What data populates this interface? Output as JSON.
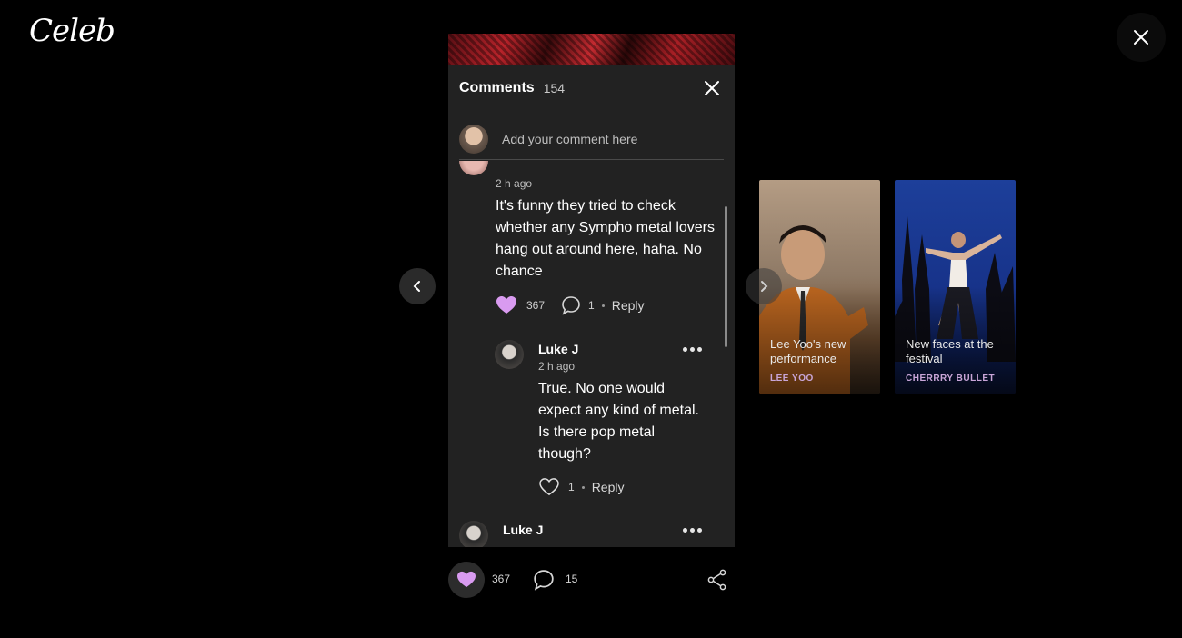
{
  "app": {
    "logo": "Celeb"
  },
  "comments_panel": {
    "title": "Comments",
    "count": "154",
    "add_comment_placeholder": "Add your comment here",
    "thread": [
      {
        "time": "2 h ago",
        "text": "It's funny they tried to check whether any Sympho metal lovers hang out around here, haha. No chance",
        "likes": "367",
        "replies": "1",
        "reply_label": "Reply",
        "liked": true,
        "reply_items": [
          {
            "author": "Luke J",
            "time": "2 h ago",
            "text": "True. No one would expect any kind of metal. Is there pop metal though?",
            "likes": "1",
            "reply_label": "Reply",
            "liked": false
          }
        ]
      },
      {
        "author": "Luke J"
      }
    ]
  },
  "post_actions": {
    "likes": "367",
    "comments": "15"
  },
  "related": [
    {
      "title": "Lee Yoo's new performance",
      "tag": "LEE YOO",
      "tag_color": "#c9a6d8"
    },
    {
      "title": "New faces at the festival",
      "tag": "CHERRRY BULLET",
      "tag_color": "#c9a6d8"
    }
  ],
  "colors": {
    "accent": "#d99bf0",
    "background": "#000000",
    "panel": "#222222"
  }
}
